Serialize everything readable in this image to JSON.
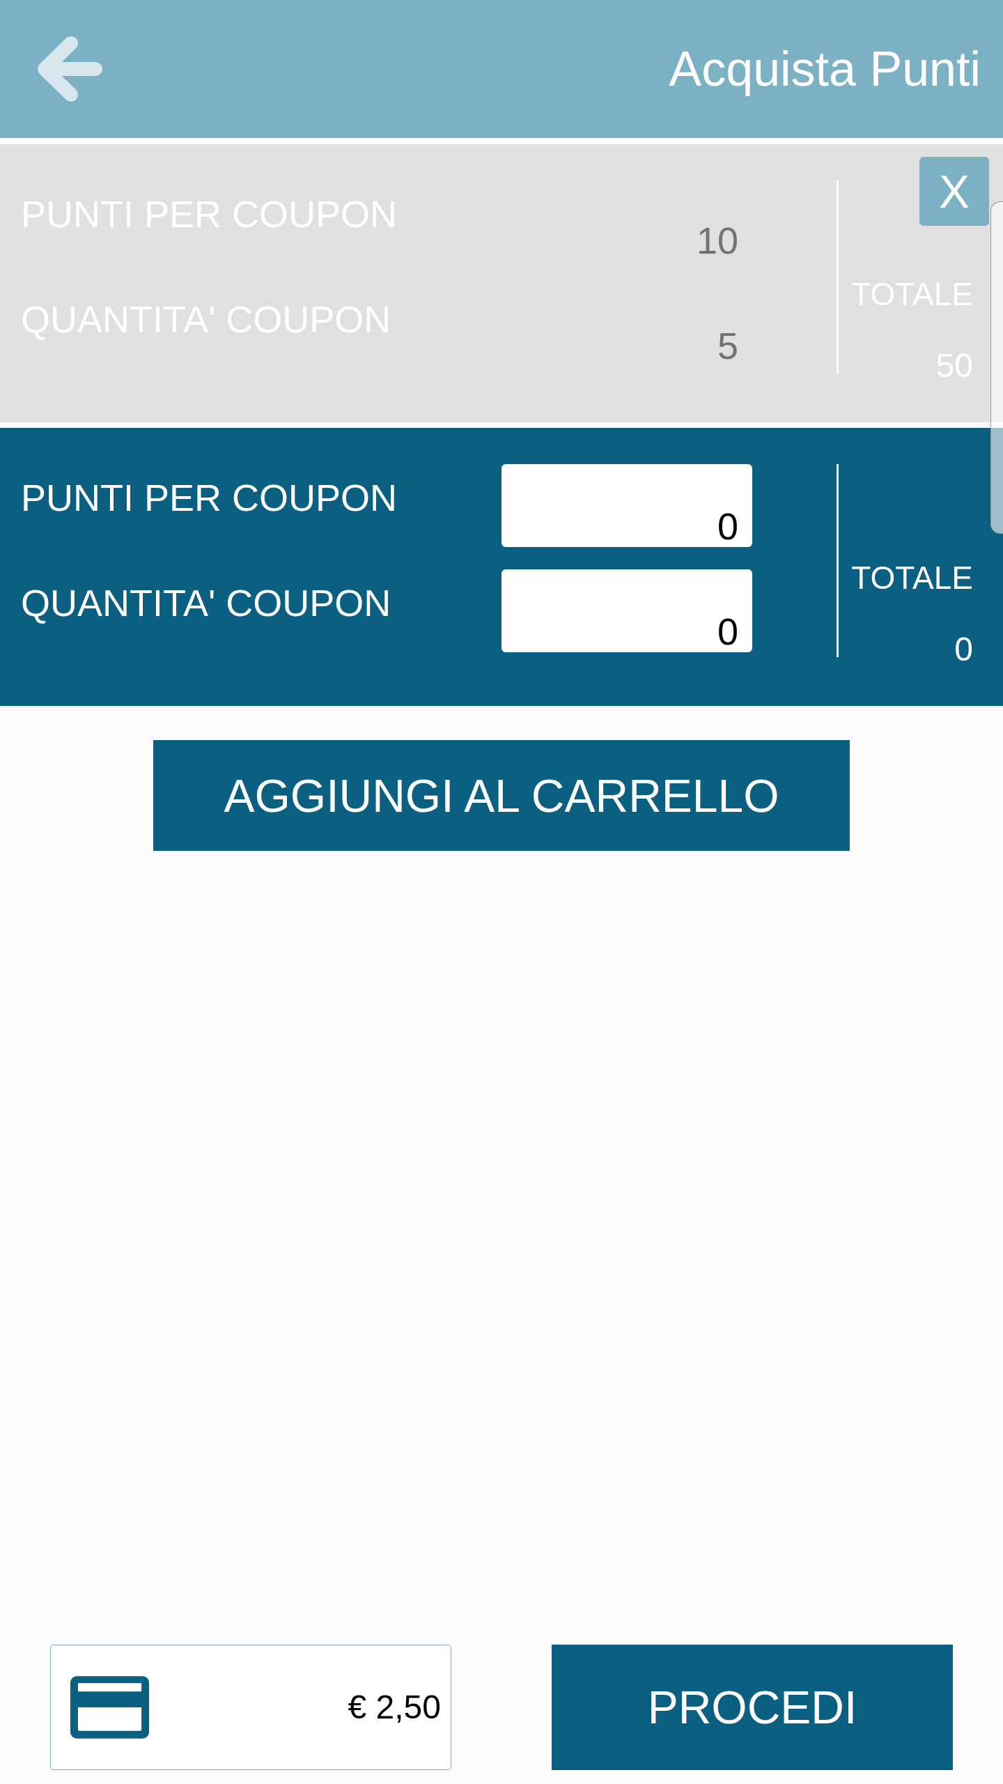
{
  "header": {
    "title": "Acquista Punti"
  },
  "cart_items": [
    {
      "fields": [
        {
          "label": "PUNTI PER COUPON",
          "value": "10"
        },
        {
          "label": "QUANTITA' COUPON",
          "value": "5"
        }
      ],
      "total_label": "TOTALE",
      "total": "50",
      "remove": "X"
    }
  ],
  "new_item": {
    "fields": [
      {
        "label": "PUNTI PER COUPON",
        "value": "0"
      },
      {
        "label": "QUANTITA' COUPON",
        "value": "0"
      }
    ],
    "total_label": "TOTALE",
    "total": "0"
  },
  "add_button": "AGGIUNGI AL CARRELLO",
  "footer": {
    "amount": "€ 2,50",
    "proceed_button": "PROCEDI"
  }
}
